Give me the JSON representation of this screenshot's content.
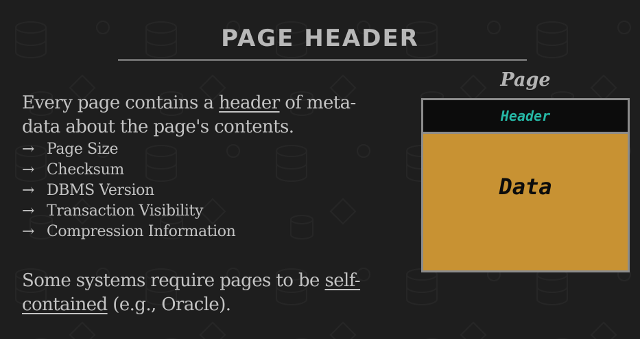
{
  "slide": {
    "title": "PAGE HEADER",
    "intro": {
      "part1": "Every page contains a ",
      "link": "header",
      "part2": " of meta-data about the page's contents."
    },
    "bullets": [
      "Page Size",
      "Checksum",
      "DBMS Version",
      "Transaction Visibility",
      "Compression Information"
    ],
    "bullet_arrow": "→",
    "outro": {
      "part1": "Some systems require pages to be ",
      "link": "self-contained",
      "part2": " (e.g., Oracle)."
    }
  },
  "diagram": {
    "caption": "Page",
    "header_label": "Header",
    "data_label": "Data",
    "colors": {
      "header_bg": "#0c0c0c",
      "header_text": "#26b8a6",
      "data_bg": "#c89233",
      "border": "#8c8c8c"
    }
  },
  "colors": {
    "background": "#1e1e1e",
    "text": "#c4c4c4",
    "title": "#b8b8b8"
  }
}
